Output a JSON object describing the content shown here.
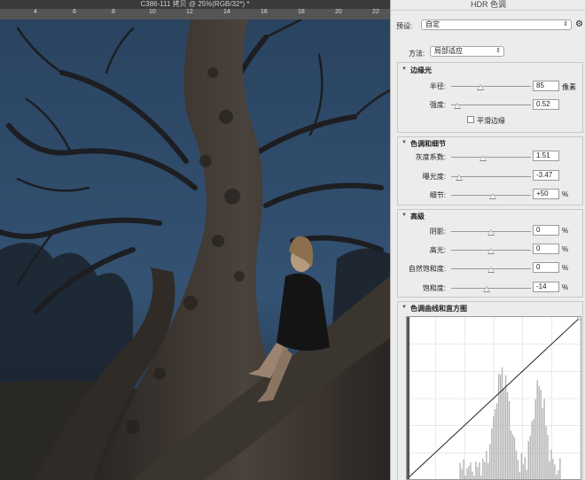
{
  "document": {
    "title": "C386-111 拷贝 @ 25%(RGB/32*) *",
    "ruler_ticks": [
      "4",
      "6",
      "8",
      "10",
      "12",
      "14",
      "16",
      "18",
      "20",
      "22"
    ]
  },
  "dialog": {
    "title": "HDR 色调",
    "preset_label": "预设:",
    "preset_value": "自定",
    "method_label": "方法:",
    "method_value": "局部适应",
    "edge_glow": {
      "title": "边缘光",
      "radius": {
        "label": "半径:",
        "value": "85",
        "unit": "像素",
        "slider": 0.37
      },
      "strength": {
        "label": "强度:",
        "value": "0.52",
        "slider": 0.08
      },
      "smooth_edges": {
        "label": "平滑边缘",
        "checked": false
      }
    },
    "tone_detail": {
      "title": "色调和细节",
      "gamma": {
        "label": "灰度系数:",
        "value": "1.51",
        "slider": 0.4
      },
      "exposure": {
        "label": "曝光度:",
        "value": "-3.47",
        "slider": 0.1
      },
      "detail": {
        "label": "细节:",
        "value": "+50",
        "unit": "%",
        "slider": 0.52
      }
    },
    "advanced": {
      "title": "高级",
      "shadow": {
        "label": "阴影:",
        "value": "0",
        "unit": "%",
        "slider": 0.5
      },
      "highlight": {
        "label": "高光:",
        "value": "0",
        "unit": "%",
        "slider": 0.5
      },
      "vibrance": {
        "label": "自然饱和度:",
        "value": "0",
        "unit": "%",
        "slider": 0.5
      },
      "saturation": {
        "label": "饱和度:",
        "value": "-14",
        "unit": "%",
        "slider": 0.44
      }
    },
    "curve": {
      "title": "色调曲线和直方图"
    }
  },
  "colors": {
    "sky": "#2e4a66",
    "dialog_bg": "#ececec"
  }
}
